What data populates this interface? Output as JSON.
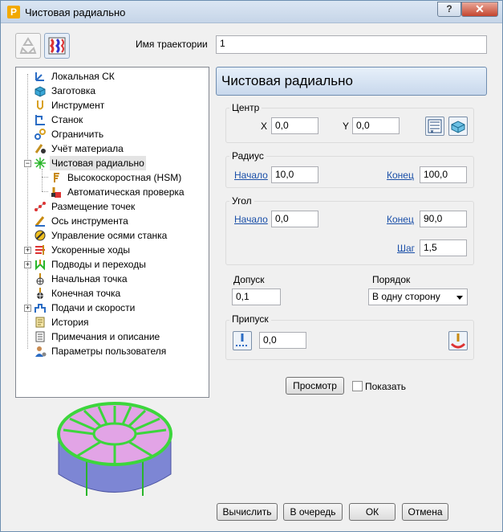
{
  "window": {
    "title": "Чистовая радиально",
    "help_glyph": "?",
    "close_glyph": "✕"
  },
  "toolpath_name": {
    "label": "Имя траектории",
    "value": "1"
  },
  "tree": {
    "items": [
      {
        "label": "Локальная СК"
      },
      {
        "label": "Заготовка"
      },
      {
        "label": "Инструмент"
      },
      {
        "label": "Станок"
      },
      {
        "label": "Ограничить"
      },
      {
        "label": "Учёт материала"
      },
      {
        "label": "Чистовая радиально"
      },
      {
        "label": "Высокоскоростная (HSM)"
      },
      {
        "label": "Автоматическая проверка"
      },
      {
        "label": "Размещение точек"
      },
      {
        "label": "Ось инструмента"
      },
      {
        "label": "Управление осями станка"
      },
      {
        "label": "Ускоренные ходы"
      },
      {
        "label": "Подводы и переходы"
      },
      {
        "label": "Начальная точка"
      },
      {
        "label": "Конечная точка"
      },
      {
        "label": "Подачи и скорости"
      },
      {
        "label": "История"
      },
      {
        "label": "Примечания и описание"
      },
      {
        "label": "Параметры пользователя"
      }
    ]
  },
  "panel": {
    "title": "Чистовая радиально",
    "center": {
      "title": "Центр",
      "x_label": "X",
      "x_value": "0,0",
      "y_label": "Y",
      "y_value": "0,0"
    },
    "radius": {
      "title": "Радиус",
      "start_label": "Начало",
      "start_value": "10,0",
      "end_label": "Конец",
      "end_value": "100,0"
    },
    "angle": {
      "title": "Угол",
      "start_label": "Начало",
      "start_value": "0,0",
      "end_label": "Конец",
      "end_value": "90,0",
      "step_label": "Шаг",
      "step_value": "1,5"
    },
    "tolerance": {
      "label": "Допуск",
      "value": "0,1"
    },
    "order": {
      "label": "Порядок",
      "value": "В одну сторону"
    },
    "allowance": {
      "title": "Припуск",
      "value": "0,0"
    },
    "preview": {
      "button_label": "Просмотр",
      "show_label": "Показать"
    }
  },
  "footer": {
    "calculate": "Вычислить",
    "queue": "В очередь",
    "ok": "ОК",
    "cancel": "Отмена"
  },
  "colors": {
    "accent": "#1a4fa8",
    "model_top": "#e2a4e6",
    "model_side": "#7d86d4",
    "model_edge": "#3cd63c"
  }
}
